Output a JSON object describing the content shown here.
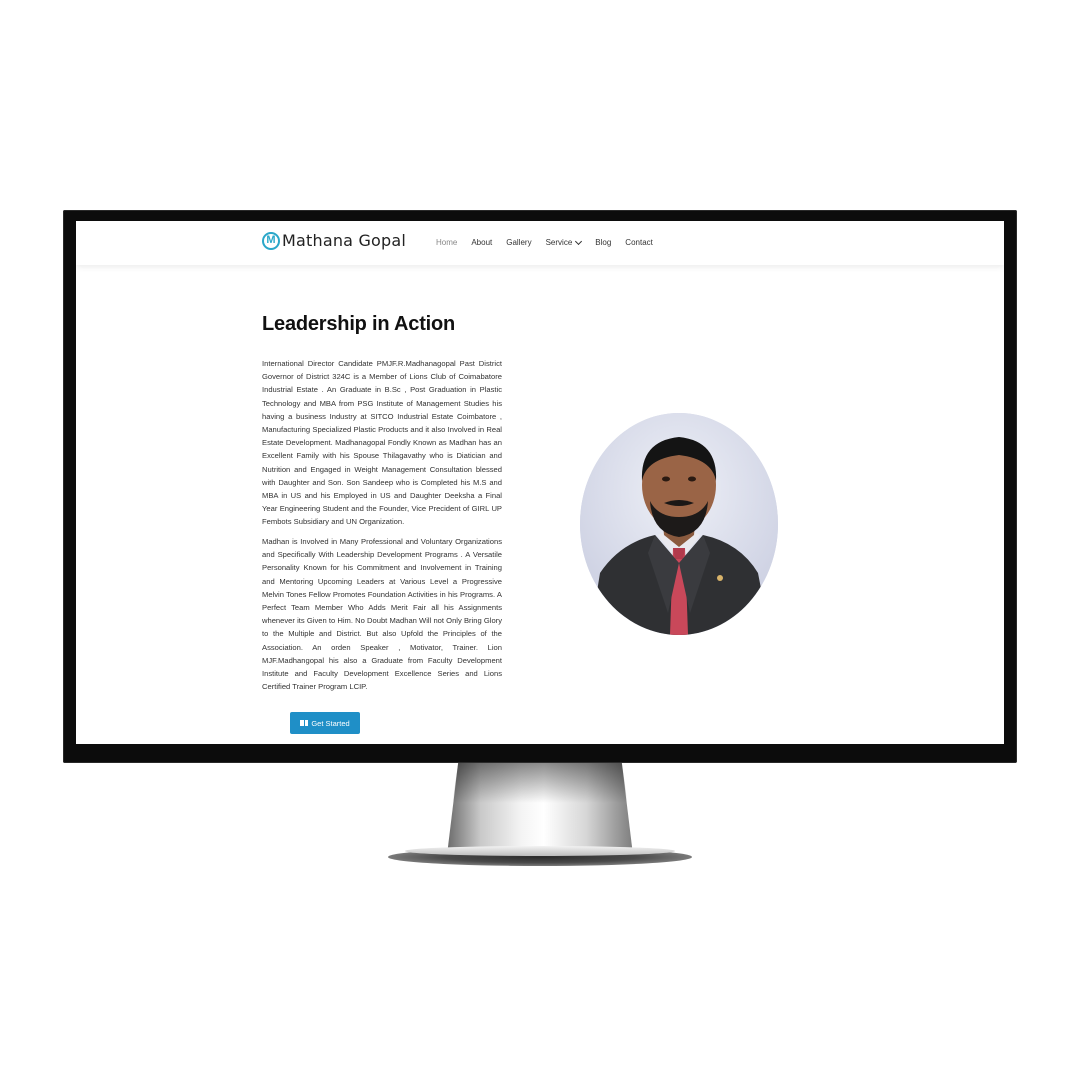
{
  "site": {
    "brand": "Mathana Gopal",
    "brand_mark": "M"
  },
  "nav": {
    "items": [
      {
        "label": "Home",
        "active": true
      },
      {
        "label": "About"
      },
      {
        "label": "Gallery"
      },
      {
        "label": "Service",
        "dropdown": true
      },
      {
        "label": "Blog"
      },
      {
        "label": "Contact"
      }
    ]
  },
  "main": {
    "heading": "Leadership in Action",
    "paragraph1": "International Director Candidate PMJF.R.Madhanagopal Past District Governor of District 324C is a Member of Lions Club of Coimabatore Industrial Estate . An Graduate in B.Sc , Post Graduation in Plastic Technology and MBA from PSG Institute of Management Studies his having a business Industry at SITCO Industrial Estate Coimbatore , Manufacturing Specialized Plastic Products and it also Involved in Real Estate Development. Madhanagopal Fondly Known as Madhan has an Excellent Family with his Spouse Thilagavathy who is Diatician and Nutrition and Engaged in Weight Management Consultation blessed with Daughter and Son. Son Sandeep who is Completed his M.S and MBA in US and his Employed in US and Daughter Deeksha a Final Year Engineering Student and the Founder, Vice Precident of GIRL UP Fembots Subsidiary and UN Organization.",
    "paragraph2": "Madhan is Involved in Many Professional and Voluntary Organizations and Specifically With Leadership Development Programs . A Versatile Personality Known for his Commitment and Involvement in Training and Mentoring Upcoming Leaders at Various Level a Progressive Melvin Tones Fellow Promotes Foundation Activities in his Programs. A Perfect Team Member Who Adds Merit Fair all his Assignments whenever its Given to Him. No Doubt Madhan Will not Only Bring Glory to the Multiple and District. But also Upfold the Principles of the Association. An orden Speaker , Motivator, Trainer. Lion MJF.Madhangopal his also a Graduate from Faculty Development Institute and Faculty Development Excellence Series and Lions Certified Trainer Program LCIP.",
    "cta_label": "Get Started",
    "cta_icon": "book-icon"
  },
  "colors": {
    "accent": "#1f8fc7",
    "brand_mark": "#2aa7c9",
    "portrait_bg": "#d4d8e6"
  }
}
